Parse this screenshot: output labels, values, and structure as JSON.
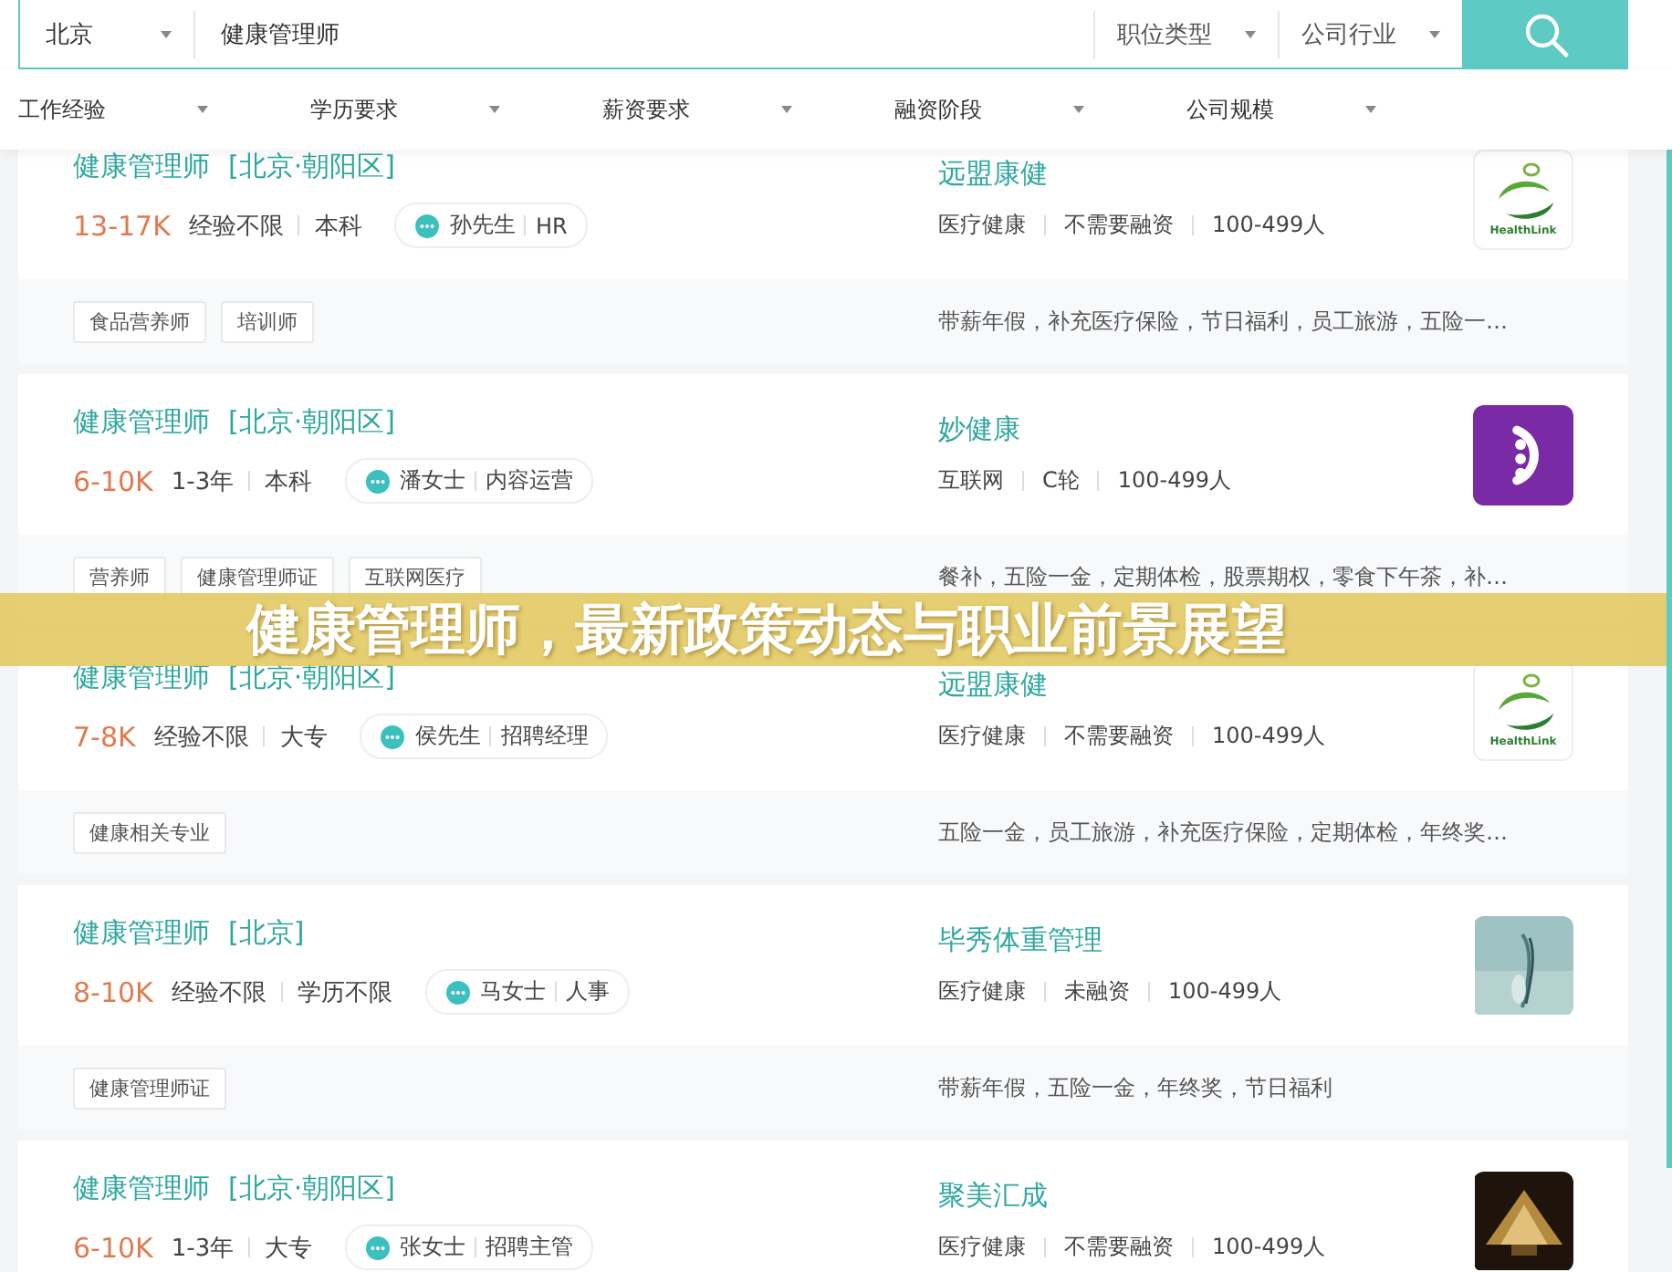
{
  "search": {
    "city": "北京",
    "keyword": "健康管理师",
    "dropdowns": [
      "职位类型",
      "公司行业"
    ]
  },
  "filters": [
    "工作经验",
    "学历要求",
    "薪资要求",
    "融资阶段",
    "公司规模"
  ],
  "jobs": [
    {
      "title": "健康管理师",
      "location": "[北京·朝阳区]",
      "salary": "13-17K",
      "experience": "经验不限",
      "education": "本科",
      "recruiter": "孙先生",
      "role": "HR",
      "company": "远盟康健",
      "industry": "医疗健康",
      "funding": "不需要融资",
      "size": "100-499人",
      "logo": {
        "kind": "leaf",
        "text": "HealthLink"
      },
      "tags": [
        "食品营养师",
        "培训师"
      ],
      "benefits": "带薪年假，补充医疗保险，节日福利，员工旅游，五险一…"
    },
    {
      "title": "健康管理师",
      "location": "[北京·朝阳区]",
      "salary": "6-10K",
      "experience": "1-3年",
      "education": "本科",
      "recruiter": "潘女士",
      "role": "内容运营",
      "company": "妙健康",
      "industry": "互联网",
      "funding": "C轮",
      "size": "100-499人",
      "logo": {
        "kind": "purple"
      },
      "tags": [
        "营养师",
        "健康管理师证",
        "互联网医疗"
      ],
      "benefits": "餐补，五险一金，定期体检，股票期权，零食下午茶，补…"
    },
    {
      "title": "健康管理师",
      "location": "[北京·朝阳区]",
      "salary": "7-8K",
      "experience": "经验不限",
      "education": "大专",
      "recruiter": "侯先生",
      "role": "招聘经理",
      "company": "远盟康健",
      "industry": "医疗健康",
      "funding": "不需要融资",
      "size": "100-499人",
      "logo": {
        "kind": "leaf",
        "text": "HealthLink"
      },
      "tags": [
        "健康相关专业"
      ],
      "benefits": "五险一金，员工旅游，补充医疗保险，定期体检，年终奖…"
    },
    {
      "title": "健康管理师",
      "location": "[北京]",
      "salary": "8-10K",
      "experience": "经验不限",
      "education": "学历不限",
      "recruiter": "马女士",
      "role": "人事",
      "company": "毕秀体重管理",
      "industry": "医疗健康",
      "funding": "未融资",
      "size": "100-499人",
      "logo": {
        "kind": "picture"
      },
      "tags": [
        "健康管理师证"
      ],
      "benefits": "带薪年假，五险一金，年终奖，节日福利"
    },
    {
      "title": "健康管理师",
      "location": "[北京·朝阳区]",
      "salary": "6-10K",
      "experience": "1-3年",
      "education": "大专",
      "recruiter": "张女士",
      "role": "招聘主管",
      "company": "聚美汇成",
      "industry": "医疗健康",
      "funding": "不需要融资",
      "size": "100-499人",
      "logo": {
        "kind": "dark-picture"
      }
    }
  ],
  "banner": {
    "title": "健康管理师，最新政策动态与职业前景展望"
  }
}
